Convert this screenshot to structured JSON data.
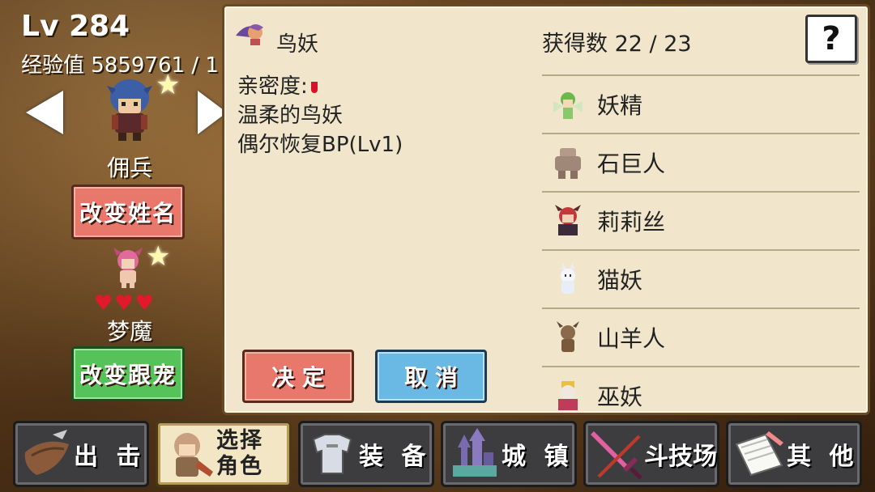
{
  "player": {
    "level": "Lv 284",
    "exp": "经验值 5859761 / 1"
  },
  "hero": {
    "name": "佣兵",
    "rename_label": "改变姓名"
  },
  "pet": {
    "name": "梦魔",
    "hearts": "♥♥♥",
    "change_label": "改变跟宠"
  },
  "panel": {
    "monster_name": "鸟妖",
    "affinity_label": "亲密度:",
    "desc_line1": "温柔的鸟妖",
    "desc_line2": "偶尔恢复BP(Lv1)",
    "count": "获得数 22 / 23",
    "help": "?",
    "confirm_label": "决 定",
    "cancel_label": "取 消",
    "monsters": [
      {
        "name": "妖精",
        "icon": "fairy-icon"
      },
      {
        "name": "石巨人",
        "icon": "golem-icon"
      },
      {
        "name": "莉莉丝",
        "icon": "lilith-icon"
      },
      {
        "name": "猫妖",
        "icon": "cat-icon"
      },
      {
        "name": "山羊人",
        "icon": "goatman-icon"
      },
      {
        "name": "巫妖",
        "icon": "lich-icon"
      }
    ]
  },
  "nav": [
    {
      "label": "出 击",
      "icon": "wing-icon"
    },
    {
      "label": "选择角色",
      "line1": "选择",
      "line2": "角色",
      "icon": "character-icon",
      "selected": true
    },
    {
      "label": "装 备",
      "icon": "armor-icon"
    },
    {
      "label": "城 镇",
      "icon": "castle-icon"
    },
    {
      "label": "斗技场",
      "icon": "sword-icon"
    },
    {
      "label": "其 他",
      "icon": "notebook-icon"
    }
  ],
  "colors": {
    "panel": "#f1e6cc",
    "red_button": "#e8776c",
    "green_button": "#55c35a",
    "blue_button": "#6ab8e4"
  }
}
